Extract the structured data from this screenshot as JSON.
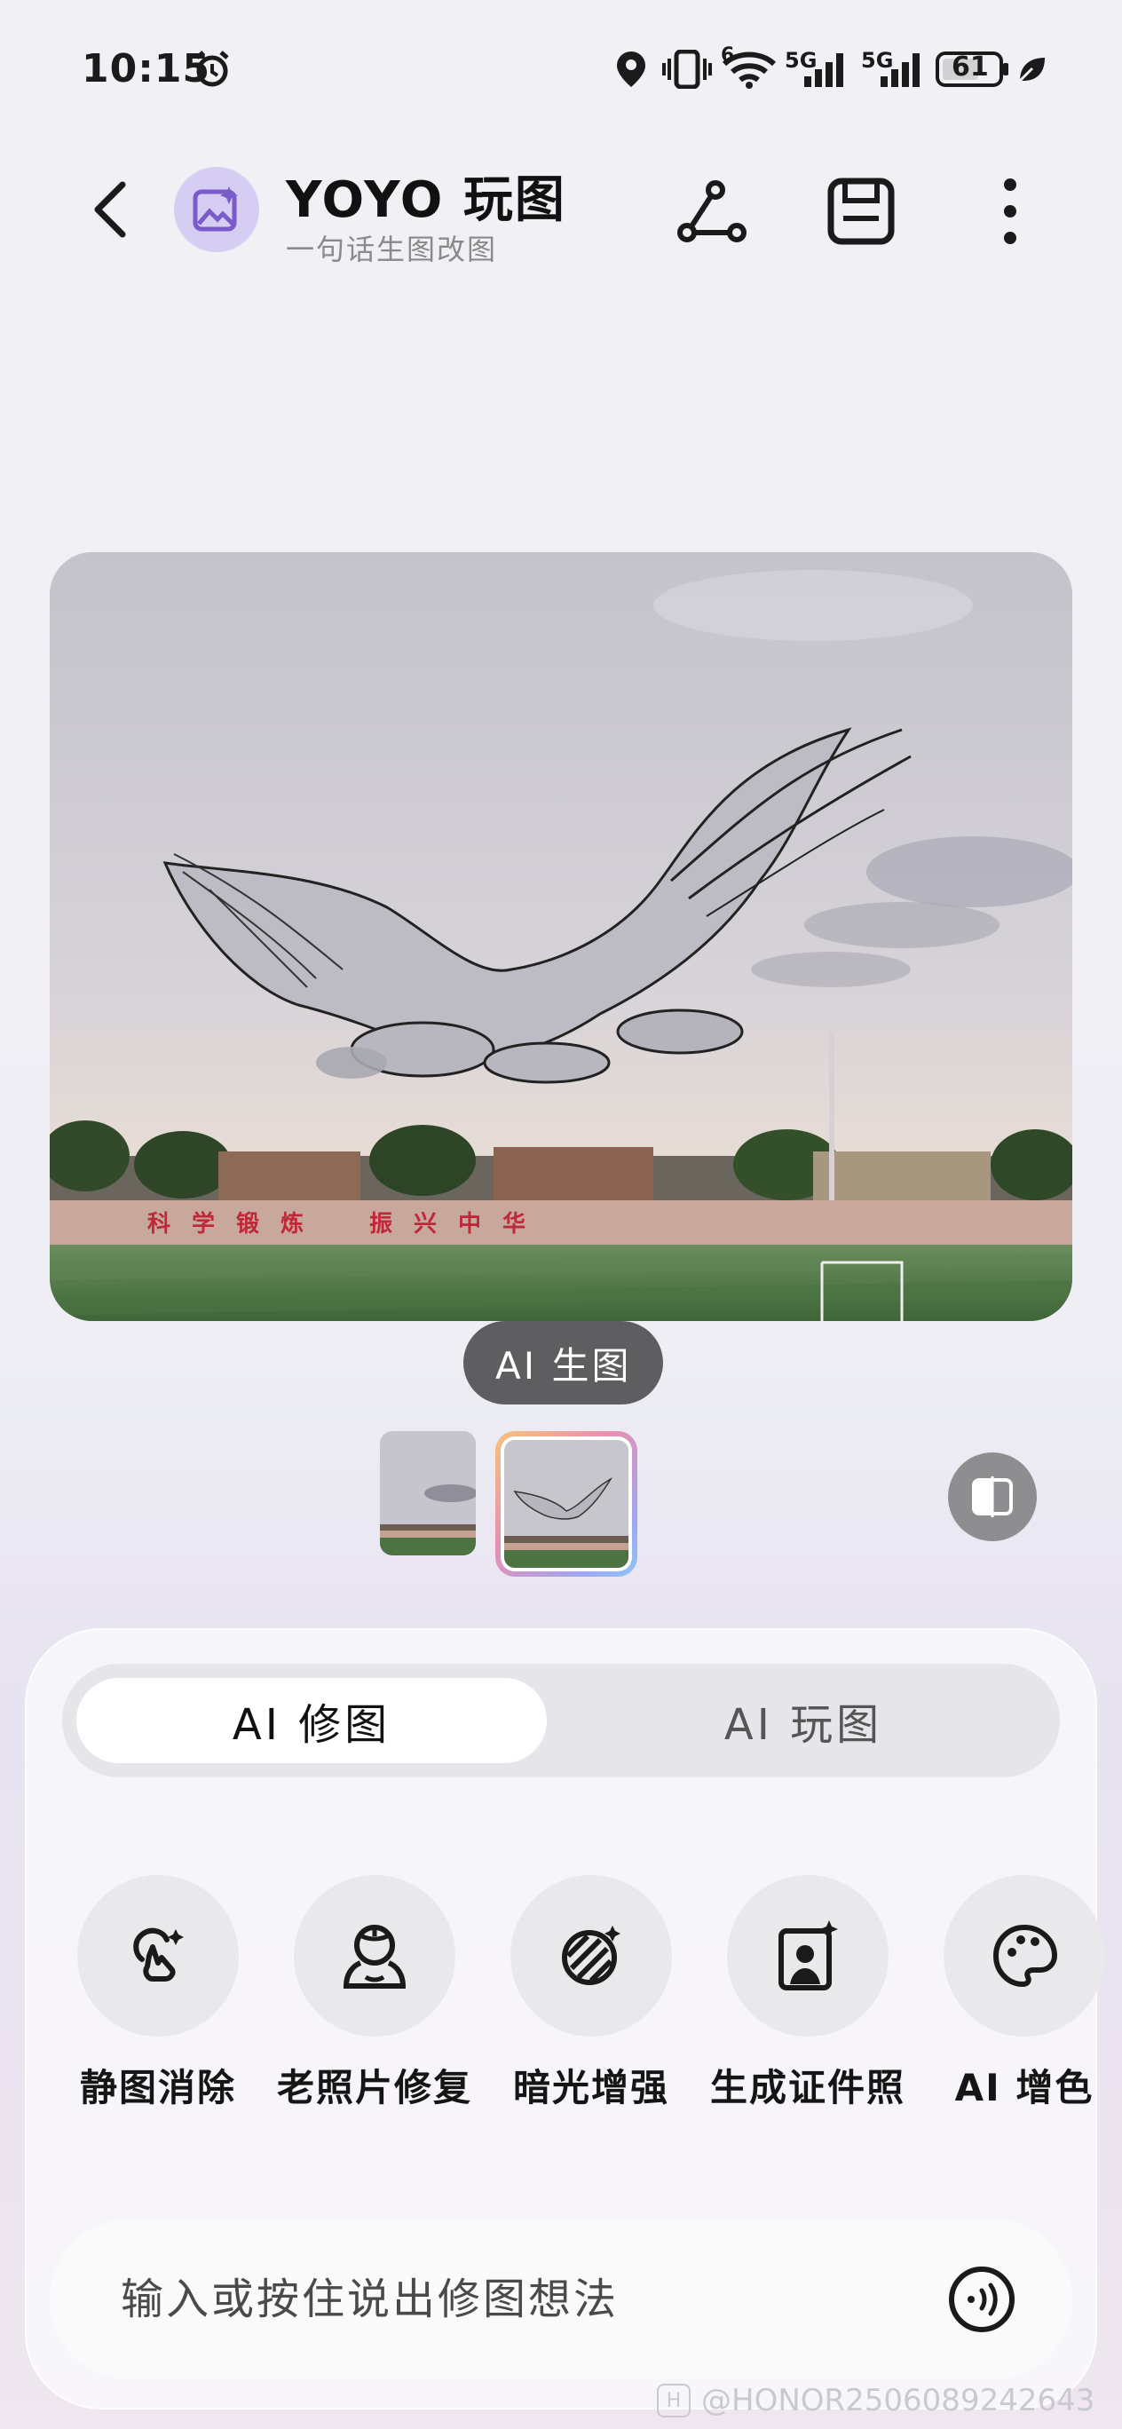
{
  "status_bar": {
    "time": "10:15",
    "network_label_1": "5G",
    "network_label_2": "5G",
    "wifi_label": "6",
    "battery": "61",
    "icons": [
      "alarm-icon",
      "location-icon",
      "vibrate-icon",
      "wifi-icon",
      "signal-icon",
      "signal-icon",
      "battery-icon",
      "eco-leaf-icon"
    ]
  },
  "header": {
    "title": "YOYO 玩图",
    "subtitle": "一句话生图改图",
    "icons": [
      "back-icon",
      "app-logo-icon",
      "share-icon",
      "save-icon",
      "more-icon"
    ]
  },
  "preview": {
    "banner_text": [
      "科",
      "学",
      "锻",
      "炼",
      "振",
      "兴",
      "中",
      "华"
    ]
  },
  "chip": {
    "label": "AI 生图"
  },
  "thumbnails": {
    "count": 2,
    "selected_index": 1
  },
  "tabs": [
    {
      "label": "AI 修图",
      "active": true
    },
    {
      "label": "AI 玩图",
      "active": false
    }
  ],
  "tools": [
    {
      "label": "静图消除",
      "icon": "erase-icon"
    },
    {
      "label": "老照片修复",
      "icon": "portrait-restore-icon"
    },
    {
      "label": "暗光增强",
      "icon": "low-light-icon"
    },
    {
      "label": "生成证件照",
      "icon": "id-photo-icon"
    },
    {
      "label": "AI 增色",
      "icon": "palette-icon"
    }
  ],
  "input": {
    "placeholder": "输入或按住说出修图想法"
  },
  "watermark": {
    "text": "@HONOR2506089242643"
  },
  "colors": {
    "accent": "#8b6fd6",
    "chip_bg": "#5e5e60",
    "panel_bg": "#fafafc"
  }
}
